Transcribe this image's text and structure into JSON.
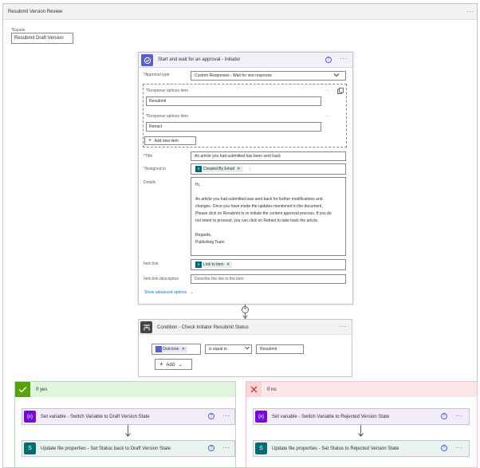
{
  "outer": {
    "title": "Resubmit Version Review",
    "more": "···",
    "equals_label": "Equals",
    "equals_value": "Resubmit Draft Version"
  },
  "approval": {
    "title": "Start and wait for an approval - Initiator",
    "help": "?",
    "more": "···",
    "approval_type_label": "Approval type",
    "approval_type_value": "Custom Responses - Wait for one response",
    "response_label": "Response options Item",
    "responses": [
      "Resubmit",
      "Retract"
    ],
    "add_new_item": "Add new item",
    "title_label": "Title",
    "title_value": "An article you had submitted has been sent back",
    "assigned_label": "Assigned to",
    "assigned_tag": "Created By Email",
    "details_label": "Details",
    "details_lines": [
      "Hi,",
      "",
      "An article you had submitted was sent back for further modifications and",
      "changes. Once you have made the updates mentioned in the document,",
      "Please click on Resubmit to re initiate the content approval process. If you do",
      "not intent to proceed, you can click on Retract to take back the article.",
      "",
      "Regards,",
      "Publishing Team"
    ],
    "item_link_label": "Item link",
    "item_link_tag": "Link to item",
    "item_link_desc_label": "Item link description",
    "item_link_desc_placeholder": "Describe the link to the item",
    "show_advanced": "Show advanced options"
  },
  "condition": {
    "title": "Condition - Check Initiator Resubmit Status",
    "more": "···",
    "left_tag": "Outcome",
    "operator": "is equal to",
    "right_value": "Resubmit",
    "add_label": "Add"
  },
  "branches": {
    "yes": {
      "label": "If yes",
      "action1": "Set variable - Switch Variable to Draft Version State",
      "action2": "Update file properties - Set Status back to Draft Version State"
    },
    "no": {
      "label": "If no",
      "action1": "Set variable - Switch Variable to Rejected Version State",
      "action2": "Update file properties - Set Status to Rejected Version State"
    }
  },
  "colors": {
    "approval_accent": "#5b5fc7",
    "condition_accent": "#484644",
    "variable_accent": "#770bd6",
    "sharepoint_accent": "#036c70",
    "yes_accent": "#57a300",
    "no_accent": "#d13438"
  }
}
